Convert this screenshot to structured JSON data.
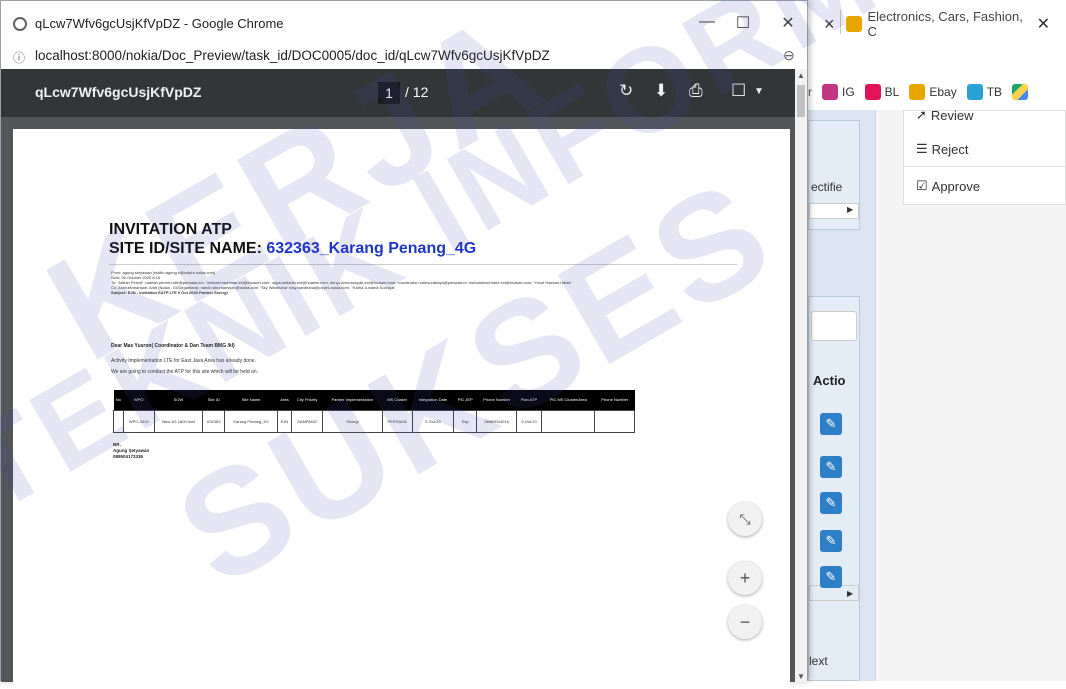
{
  "popup": {
    "window_title": "qLcw7Wfv6gcUsjKfVpDZ - Google Chrome",
    "url": "localhost:8000/nokia/Doc_Preview/task_id/DOC0005/doc_id/qLcw7Wfv6gcUsjKfVpDZ",
    "minimize": "—",
    "maximize": "☐",
    "close": "✕"
  },
  "pdf_viewer": {
    "doc_title": "qLcw7Wfv6gcUsjKfVpDZ",
    "current_page": "1",
    "total_pages": "/ 12",
    "icons": [
      "rotate-icon",
      "download-icon",
      "print-icon",
      "bookmark-icon"
    ]
  },
  "document": {
    "heading": "INVITATION ATP",
    "site_prefix": "SITE ID/SITE NAME: ",
    "site_name": "632363_Karang Penang_4G",
    "email_from": "From: agung setyawan [mailto:agung.s@colphi-nokia.com]",
    "email_sent": "Sent: 06 October 2020 8:16",
    "email_to": "To: 'Adrian Permit' <adrian.permit.rolfe@persada.id>; 'michael.rachman.ext@huawei.com'; agus.setiadio.ext@huawei.com; deny.rochmansyah.ext@huawei.com; coordinator.rudiesurabaya@persada.id; muhammad.hafiz.ext@huawei.com; 'Yusuf Haesan.Habib'",
    "email_cc": "Cc: Zahrulfirmansah; Andi (Nokia - ID/Dirgantara); nandi.rahumansyah@nokia.com; 'Sky Wardhana' roky.wardhana@colphi-nokia.com; 'Yudha Junaedi Sudrajat'",
    "email_subject": "Subject: EJN - Invitation EATP LTE 9 Oct 2020 Partner Sinergi",
    "greeting": "Dear Mas Yusron( Coordinator & Dan Team BMG /kl)",
    "para1": "Activity Implementation LTE for East Java Area has already done.",
    "para2": "We are going to conduct the ATP for this site which will be held on.",
    "table_headers": [
      "No",
      "WPO",
      "SOW",
      "Site ID",
      "Site Name",
      "Area",
      "City Priority",
      "Partner Implementation",
      "MS Cluster",
      "Integration Date",
      "PIC ATP",
      "Phone Number",
      "Plan ATP",
      "PIC MS Cluster/Area",
      "Phone Number"
    ],
    "table_row": [
      "",
      "WPO-0019",
      "New 4G 1800 Add",
      "632363",
      "Karang Penang_4G",
      "EJN",
      "SAMPANG",
      "Sinergi",
      "PERSADA",
      "2-Oct-20",
      "Esp",
      "08989004016",
      "9-Oct-20",
      "",
      ""
    ],
    "sign_regards": "BR,",
    "sign_name": "Agung Setyawan",
    "sign_phone": "089504173336"
  },
  "background_browser": {
    "tab_title": "Electronics, Cars, Fashion, C",
    "bookmarks": [
      {
        "label": "IG",
        "color": "#c13584"
      },
      {
        "label": "BL",
        "color": "#e3125a"
      },
      {
        "label": "Ebay",
        "color": "#e8a600"
      },
      {
        "label": "TB",
        "color": "#29a0d8"
      }
    ],
    "menu_review": "Review",
    "menu_reject": "Reject",
    "menu_approve": "Approve",
    "partial_rectifie": "ectifie",
    "partial_action": "Actio",
    "partial_next": "lext"
  },
  "watermark_lines": [
    "KERJA",
    "TEKNIK INFORMATIKA",
    "SUKSES"
  ]
}
